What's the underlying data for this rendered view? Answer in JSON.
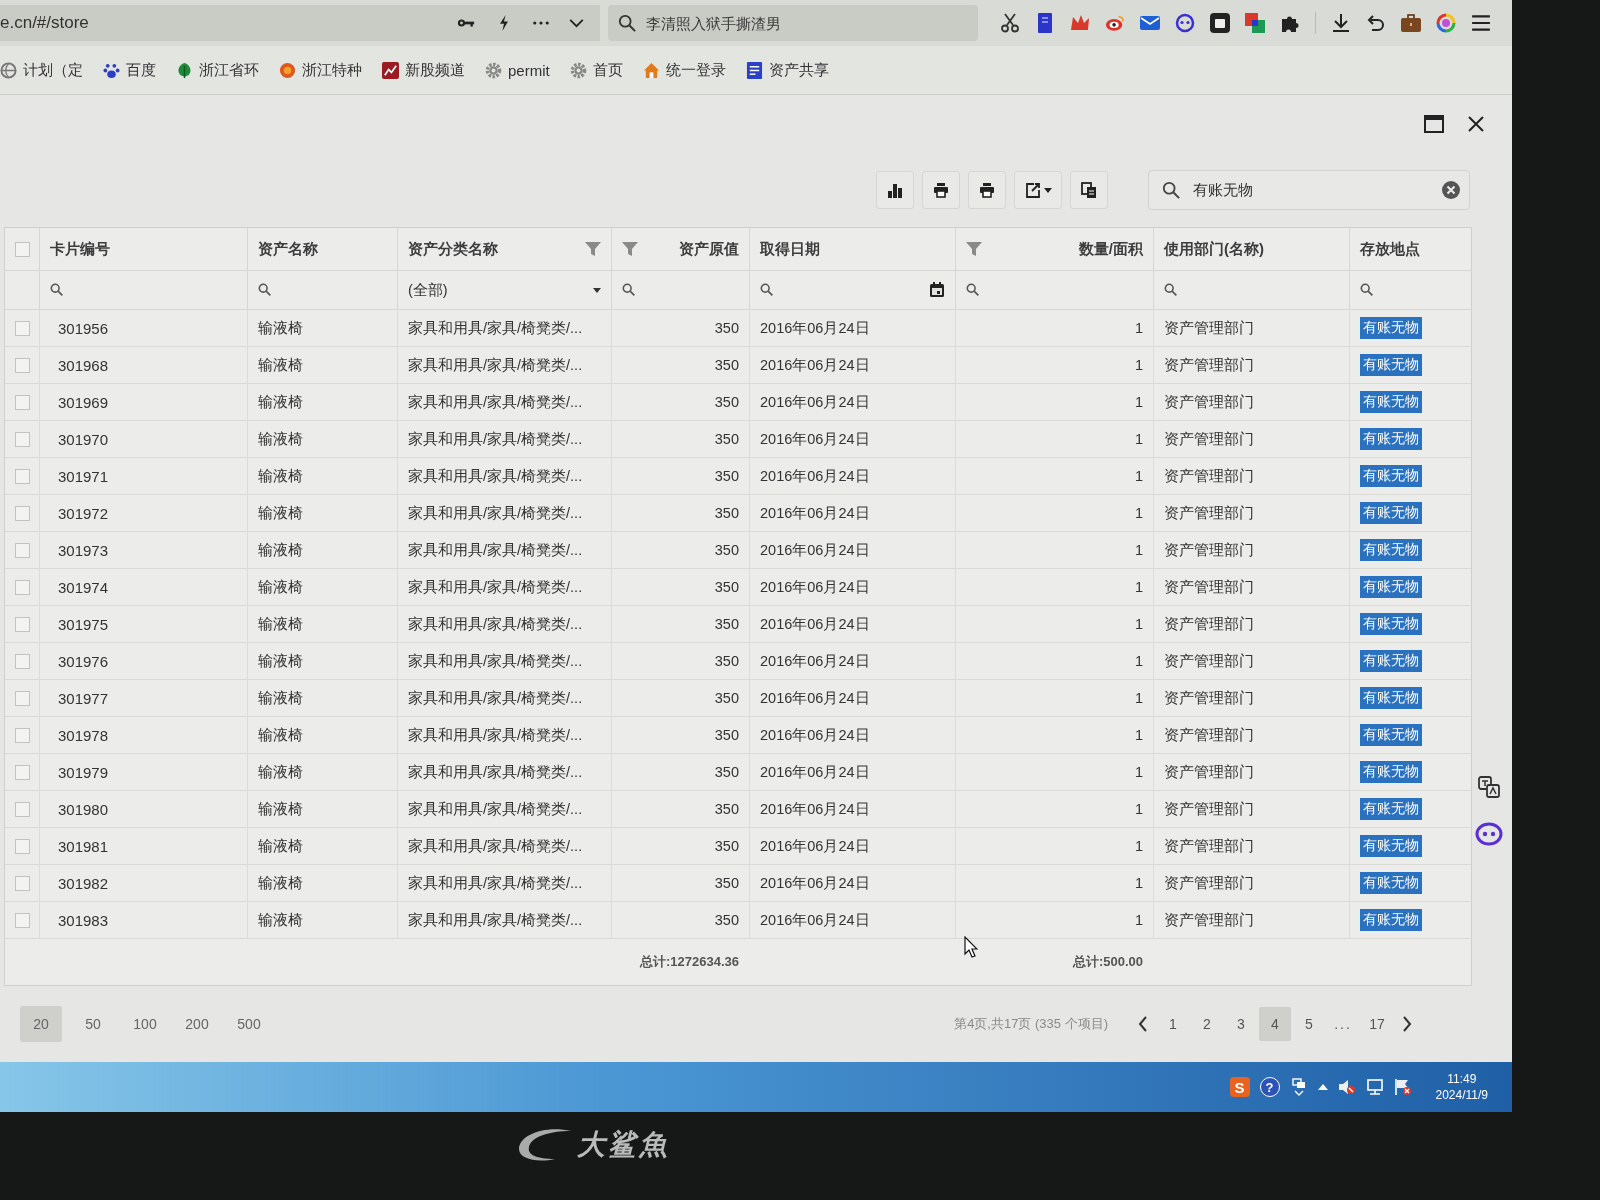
{
  "browser": {
    "url": "e.cn/#/store",
    "search": {
      "placeholder": "李清照入狱手撕渣男"
    },
    "bookmarks": [
      {
        "label": "计划（定",
        "kind": "globe"
      },
      {
        "label": "百度",
        "kind": "paw"
      },
      {
        "label": "浙江省环",
        "kind": "leaf"
      },
      {
        "label": "浙江特种",
        "kind": "badge"
      },
      {
        "label": "新股频道",
        "kind": "chart"
      },
      {
        "label": "permit",
        "kind": "gear"
      },
      {
        "label": "首页",
        "kind": "gear"
      },
      {
        "label": "统一登录",
        "kind": "house"
      },
      {
        "label": "资产共享",
        "kind": "doc"
      }
    ]
  },
  "toolbar": {
    "search": {
      "value": "有账无物"
    }
  },
  "table": {
    "select_all": {
      "checked": false
    },
    "columns": [
      {
        "label": "卡片编号",
        "kind": "id",
        "filter_icon": false,
        "filter": {
          "kind": "search"
        }
      },
      {
        "label": "资产名称",
        "kind": "text",
        "filter_icon": false,
        "filter": {
          "kind": "search"
        }
      },
      {
        "label": "资产分类名称",
        "kind": "text",
        "filter_icon": true,
        "filter": {
          "kind": "dropdown",
          "value": "(全部)"
        }
      },
      {
        "label": "资产原值",
        "kind": "number",
        "filter_icon": true,
        "filter": {
          "kind": "search"
        },
        "total": "总计:1272634.36"
      },
      {
        "label": "取得日期",
        "kind": "text",
        "filter_icon": false,
        "filter": {
          "kind": "date"
        }
      },
      {
        "label": "数量/面积",
        "kind": "number",
        "filter_icon": true,
        "filter": {
          "kind": "search"
        },
        "total": "总计:500.00"
      },
      {
        "label": "使用部门(名称)",
        "kind": "text",
        "filter_icon": false,
        "filter": {
          "kind": "search"
        }
      },
      {
        "label": "存放地点",
        "kind": "location",
        "filter_icon": false,
        "filter": {
          "kind": "search"
        }
      }
    ],
    "rows": [
      {
        "checked": false,
        "location_match": true,
        "cells": [
          "301956",
          "输液椅",
          "家具和用具/家具/椅凳类/...",
          "350",
          "2016年06月24日",
          "1",
          "资产管理部门",
          "有账无物"
        ]
      },
      {
        "checked": false,
        "location_match": true,
        "cells": [
          "301968",
          "输液椅",
          "家具和用具/家具/椅凳类/...",
          "350",
          "2016年06月24日",
          "1",
          "资产管理部门",
          "有账无物"
        ]
      },
      {
        "checked": false,
        "location_match": true,
        "cells": [
          "301969",
          "输液椅",
          "家具和用具/家具/椅凳类/...",
          "350",
          "2016年06月24日",
          "1",
          "资产管理部门",
          "有账无物"
        ]
      },
      {
        "checked": false,
        "location_match": true,
        "cells": [
          "301970",
          "输液椅",
          "家具和用具/家具/椅凳类/...",
          "350",
          "2016年06月24日",
          "1",
          "资产管理部门",
          "有账无物"
        ]
      },
      {
        "checked": false,
        "location_match": true,
        "cells": [
          "301971",
          "输液椅",
          "家具和用具/家具/椅凳类/...",
          "350",
          "2016年06月24日",
          "1",
          "资产管理部门",
          "有账无物"
        ]
      },
      {
        "checked": false,
        "location_match": true,
        "cells": [
          "301972",
          "输液椅",
          "家具和用具/家具/椅凳类/...",
          "350",
          "2016年06月24日",
          "1",
          "资产管理部门",
          "有账无物"
        ]
      },
      {
        "checked": false,
        "location_match": true,
        "cells": [
          "301973",
          "输液椅",
          "家具和用具/家具/椅凳类/...",
          "350",
          "2016年06月24日",
          "1",
          "资产管理部门",
          "有账无物"
        ]
      },
      {
        "checked": false,
        "location_match": true,
        "cells": [
          "301974",
          "输液椅",
          "家具和用具/家具/椅凳类/...",
          "350",
          "2016年06月24日",
          "1",
          "资产管理部门",
          "有账无物"
        ]
      },
      {
        "checked": false,
        "location_match": true,
        "cells": [
          "301975",
          "输液椅",
          "家具和用具/家具/椅凳类/...",
          "350",
          "2016年06月24日",
          "1",
          "资产管理部门",
          "有账无物"
        ]
      },
      {
        "checked": false,
        "location_match": true,
        "cells": [
          "301976",
          "输液椅",
          "家具和用具/家具/椅凳类/...",
          "350",
          "2016年06月24日",
          "1",
          "资产管理部门",
          "有账无物"
        ]
      },
      {
        "checked": false,
        "location_match": true,
        "cells": [
          "301977",
          "输液椅",
          "家具和用具/家具/椅凳类/...",
          "350",
          "2016年06月24日",
          "1",
          "资产管理部门",
          "有账无物"
        ]
      },
      {
        "checked": false,
        "location_match": true,
        "cells": [
          "301978",
          "输液椅",
          "家具和用具/家具/椅凳类/...",
          "350",
          "2016年06月24日",
          "1",
          "资产管理部门",
          "有账无物"
        ]
      },
      {
        "checked": false,
        "location_match": true,
        "cells": [
          "301979",
          "输液椅",
          "家具和用具/家具/椅凳类/...",
          "350",
          "2016年06月24日",
          "1",
          "资产管理部门",
          "有账无物"
        ]
      },
      {
        "checked": false,
        "location_match": true,
        "cells": [
          "301980",
          "输液椅",
          "家具和用具/家具/椅凳类/...",
          "350",
          "2016年06月24日",
          "1",
          "资产管理部门",
          "有账无物"
        ]
      },
      {
        "checked": false,
        "location_match": true,
        "cells": [
          "301981",
          "输液椅",
          "家具和用具/家具/椅凳类/...",
          "350",
          "2016年06月24日",
          "1",
          "资产管理部门",
          "有账无物"
        ]
      },
      {
        "checked": false,
        "location_match": true,
        "cells": [
          "301982",
          "输液椅",
          "家具和用具/家具/椅凳类/...",
          "350",
          "2016年06月24日",
          "1",
          "资产管理部门",
          "有账无物"
        ]
      },
      {
        "checked": false,
        "location_match": true,
        "cells": [
          "301983",
          "输液椅",
          "家具和用具/家具/椅凳类/...",
          "350",
          "2016年06月24日",
          "1",
          "资产管理部门",
          "有账无物"
        ]
      }
    ]
  },
  "pager": {
    "page_sizes": [
      {
        "label": "20",
        "selected": true
      },
      {
        "label": "50",
        "selected": false
      },
      {
        "label": "100",
        "selected": false
      },
      {
        "label": "200",
        "selected": false
      },
      {
        "label": "500",
        "selected": false
      }
    ],
    "info": "第4页,共17页 (335 个项目)",
    "pages": [
      {
        "kind": "page",
        "label": "1",
        "selected": false
      },
      {
        "kind": "page",
        "label": "2",
        "selected": false
      },
      {
        "kind": "page",
        "label": "3",
        "selected": false
      },
      {
        "kind": "page",
        "label": "4",
        "selected": true
      },
      {
        "kind": "page",
        "label": "5",
        "selected": false
      },
      {
        "kind": "ellipsis",
        "label": "...",
        "selected": false
      },
      {
        "kind": "page",
        "label": "17",
        "selected": false
      }
    ]
  },
  "taskbar": {
    "ime_glyph": "S",
    "help_glyph": "?",
    "time": "11:49",
    "date": "2024/11/9"
  },
  "monitor": {
    "brand": "大鲨魚"
  }
}
